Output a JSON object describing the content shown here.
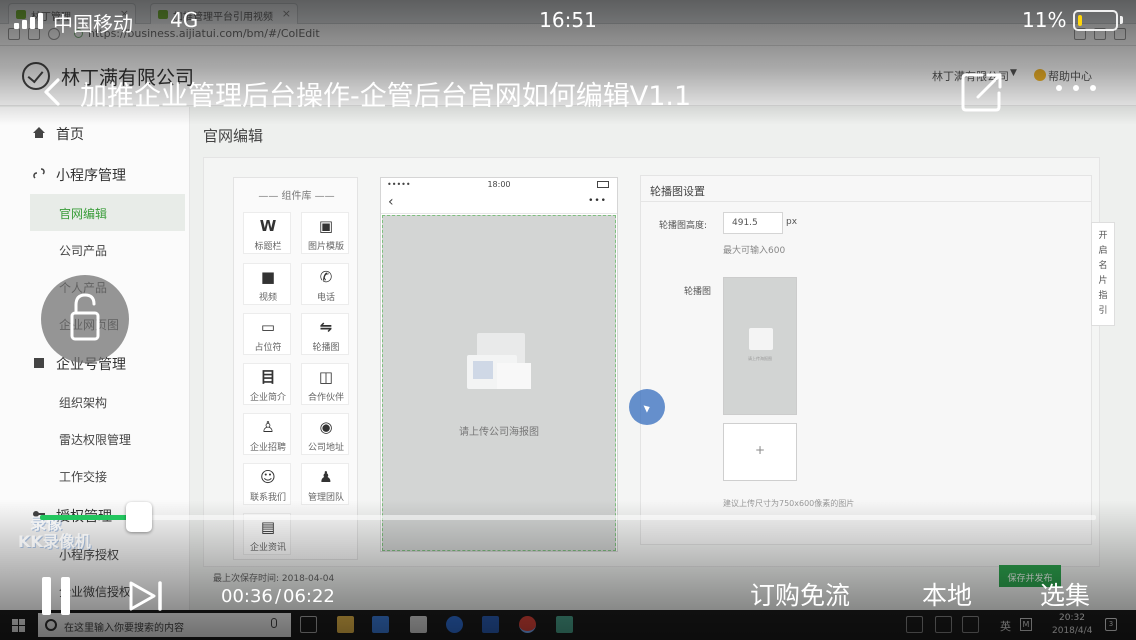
{
  "status_bar": {
    "carrier": "中国移动",
    "network": "4G",
    "time": "16:51",
    "battery_percent": "11%",
    "battery_level": 0.11,
    "battery_color": "#ffd60a"
  },
  "video": {
    "title": "加推企业管理后台操作-企管后台官网如何编辑V1.1",
    "current_time": "00:36",
    "time_separator": "/",
    "total_time": "06:22",
    "progress_fraction": 0.094,
    "progress_color": "#22c55e",
    "actions": {
      "subscribe": "订购免流",
      "local": "本地",
      "episodes": "选集"
    },
    "icons": {
      "back": "chevron-left-icon",
      "share": "share-icon",
      "more": "more-dots-icon",
      "lock": "unlock-icon",
      "pause": "pause-icon",
      "next": "next-icon"
    },
    "watermark": {
      "line1": "录像",
      "line2": "KK录像机"
    }
  },
  "recorded_screen": {
    "browser": {
      "tabs": [
        "林丁管理",
        "加推管理平台引用视频"
      ],
      "url": "https://business.aijiatui.com/bm/#/ColEdit"
    },
    "header": {
      "company_name": "林丁满有限公司",
      "user_name": "林丁满有限公司",
      "help_link": "帮助中心"
    },
    "sidebar": {
      "sections": [
        {
          "label": "首页"
        },
        {
          "label": "小程序管理"
        },
        {
          "label": "企业号管理"
        },
        {
          "label": "授权管理"
        }
      ],
      "items": [
        {
          "label": "官网编辑",
          "active": true
        },
        {
          "label": "公司产品"
        },
        {
          "label": "个人产品"
        },
        {
          "label": "企业网页图"
        },
        {
          "label": "组织架构"
        },
        {
          "label": "雷达权限管理"
        },
        {
          "label": "工作交接"
        },
        {
          "label": "小程序授权"
        },
        {
          "label": "企业微信授权"
        }
      ]
    },
    "main": {
      "page_title": "官网编辑",
      "component_library_title": "—— 组件库 ——",
      "components": [
        {
          "icon": "W",
          "label": "标题栏"
        },
        {
          "icon": "▣",
          "label": "图片模版"
        },
        {
          "icon": "■",
          "label": "视频"
        },
        {
          "icon": "✆",
          "label": "电话"
        },
        {
          "icon": "▭",
          "label": "占位符"
        },
        {
          "icon": "⇋",
          "label": "轮播图"
        },
        {
          "icon": "目",
          "label": "企业简介"
        },
        {
          "icon": "◫",
          "label": "合作伙伴"
        },
        {
          "icon": "♙",
          "label": "企业招聘"
        },
        {
          "icon": "◉",
          "label": "公司地址"
        },
        {
          "icon": "☺",
          "label": "联系我们"
        },
        {
          "icon": "♟",
          "label": "管理团队"
        },
        {
          "icon": "▤",
          "label": "企业资讯"
        }
      ],
      "phone_preview": {
        "status_dots": "•••••",
        "time": "18:00",
        "more": "•••",
        "upload_hint": "请上传公司海报图"
      },
      "settings": {
        "title": "轮播图设置",
        "height_label": "轮播图高度:",
        "height_value": "491.5",
        "height_unit": "px",
        "height_hint": "最大可输入600",
        "banner_label": "轮播图",
        "banner_thumb_text": "请上传海报图",
        "add_symbol": "+",
        "size_tip": "建议上传尺寸为750x600像素的图片"
      },
      "side_tab_chars": [
        "开",
        "启",
        "名",
        "片",
        "指",
        "引"
      ],
      "last_saved": "最上次保存时间: 2018-04-04",
      "save_publish": "保存并发布"
    },
    "taskbar": {
      "search_placeholder": "在这里输入你要搜索的内容",
      "ime": "英",
      "ime_mode": "M",
      "time": "20:32",
      "date": "2018/4/4"
    }
  }
}
